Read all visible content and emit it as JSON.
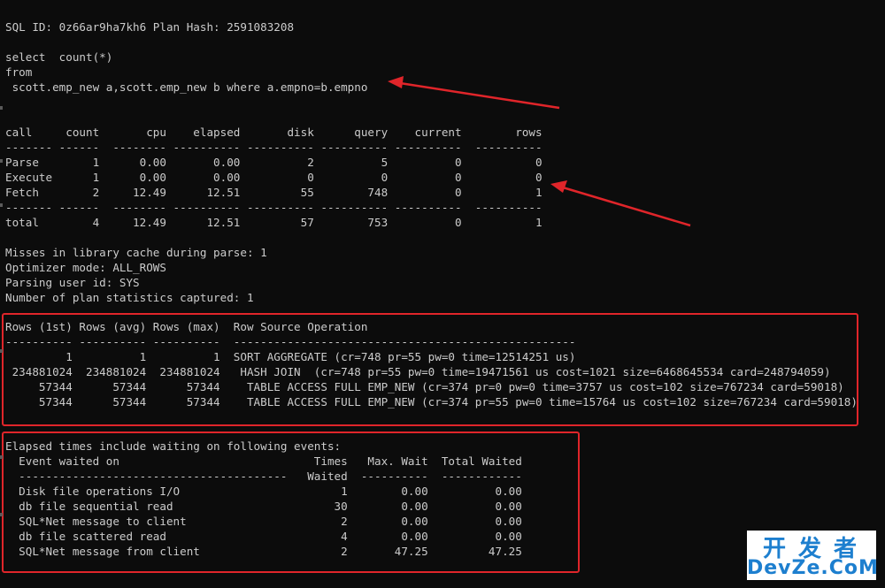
{
  "header": {
    "sql_id_line": "SQL ID: 0z66ar9ha7kh6 Plan Hash: 2591083208"
  },
  "query": {
    "line1": "select  count(*)",
    "line2": "from",
    "line3": " scott.emp_new a,scott.emp_new b where a.empno=b.empno"
  },
  "stats": {
    "header": "call     count       cpu    elapsed       disk      query    current        rows",
    "separator": "------- ------  -------- ---------- ---------- ---------- ----------  ----------",
    "rows": [
      "Parse        1      0.00       0.00          2          5          0           0",
      "Execute      1      0.00       0.00          0          0          0           0",
      "Fetch        2     12.49      12.51         55        748          0           1"
    ],
    "separator2": "------- ------  -------- ---------- ---------- ---------- ----------  ----------",
    "total": "total        4     12.49      12.51         57        753          0           1"
  },
  "misc": [
    "Misses in library cache during parse: 1",
    "Optimizer mode: ALL_ROWS",
    "Parsing user id: SYS",
    "Number of plan statistics captured: 1"
  ],
  "plan": {
    "header": "Rows (1st) Rows (avg) Rows (max)  Row Source Operation",
    "separator": "---------- ---------- ----------  ---------------------------------------------------",
    "rows": [
      "         1          1          1  SORT AGGREGATE (cr=748 pr=55 pw=0 time=12514251 us)",
      " 234881024  234881024  234881024   HASH JOIN  (cr=748 pr=55 pw=0 time=19471561 us cost=1021 size=6468645534 card=248794059)",
      "     57344      57344      57344    TABLE ACCESS FULL EMP_NEW (cr=374 pr=0 pw=0 time=3757 us cost=102 size=767234 card=59018)",
      "     57344      57344      57344    TABLE ACCESS FULL EMP_NEW (cr=374 pr=55 pw=0 time=15764 us cost=102 size=767234 card=59018)"
    ]
  },
  "waits": {
    "title": "Elapsed times include waiting on following events:",
    "header1": "  Event waited on                             Times   Max. Wait  Total Waited",
    "header2": "  ----------------------------------------   Waited  ----------  ------------",
    "rows": [
      "  Disk file operations I/O                        1        0.00          0.00",
      "  db file sequential read                        30        0.00          0.00",
      "  SQL*Net message to client                       2        0.00          0.00",
      "  db file scattered read                          4        0.00          0.00",
      "  SQL*Net message from client                     2       47.25         47.25"
    ]
  },
  "watermark": {
    "cn": "开发者",
    "en": "DevZe.CoM"
  },
  "colors": {
    "background": "#0c0c0c",
    "text": "#cccccc",
    "highlight": "#e0252a",
    "watermark": "#1d7fcf"
  }
}
